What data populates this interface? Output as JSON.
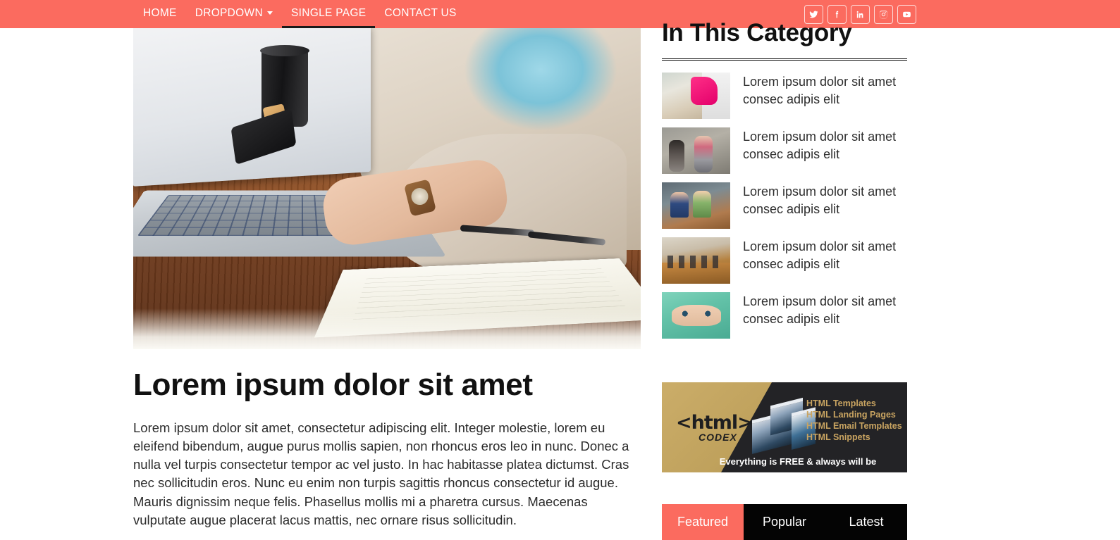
{
  "theme": {
    "accent": "#FB6B5F",
    "dark": "#040404",
    "gold": "#c9a461",
    "text": "#2b2b2b"
  },
  "navbar": {
    "items": [
      {
        "label": "HOME",
        "active": false,
        "has_caret": false
      },
      {
        "label": "DROPDOWN",
        "active": false,
        "has_caret": true
      },
      {
        "label": "SINGLE PAGE",
        "active": true,
        "has_caret": false
      },
      {
        "label": "CONTACT US",
        "active": false,
        "has_caret": false
      }
    ],
    "social": [
      {
        "name": "twitter-icon",
        "label": "Twitter"
      },
      {
        "name": "facebook-icon",
        "label": "Facebook"
      },
      {
        "name": "linkedin-icon",
        "label": "LinkedIn"
      },
      {
        "name": "instagram-icon",
        "label": "Instagram"
      },
      {
        "name": "youtube-icon",
        "label": "YouTube"
      }
    ]
  },
  "article": {
    "image_alt": "Woman typing on a laptop at a wooden desk with coffee cup, phone, notebook and pens",
    "title": "Lorem ipsum dolor sit amet",
    "body": "Lorem ipsum dolor sit amet, consectetur adipiscing elit. Integer molestie, lorem eu eleifend bibendum, augue purus mollis sapien, non rhoncus eros leo in nunc. Donec a nulla vel turpis consectetur tempor ac vel justo. In hac habitasse platea dictumst. Cras nec sollicitudin eros. Nunc eu enim non turpis sagittis rhoncus consectetur id augue. Mauris dignissim neque felis. Phasellus mollis mi a pharetra cursus. Maecenas vulputate augue placerat lacus mattis, nec ornare risus sollicitudin."
  },
  "sidebar": {
    "heading": "In This Category",
    "items": [
      {
        "text": "Lorem ipsum dolor sit amet consec adipis elit",
        "thumb": "woman-in-pink-top-with-phone"
      },
      {
        "text": "Lorem ipsum dolor sit amet consec adipis elit",
        "thumb": "women-exercising-on-stairs"
      },
      {
        "text": "Lorem ipsum dolor sit amet consec adipis elit",
        "thumb": "kids-cheering-at-laptop"
      },
      {
        "text": "Lorem ipsum dolor sit amet consec adipis elit",
        "thumb": "meeting-room-conference-table"
      },
      {
        "text": "Lorem ipsum dolor sit amet consec adipis elit",
        "thumb": "woman-in-green-headscarf"
      }
    ]
  },
  "ad": {
    "logo": "<html>",
    "logo_sub": "CODEX",
    "lines": [
      "HTML Templates",
      "HTML Landing Pages",
      "HTML Email Templates",
      "HTML Snippets"
    ],
    "footer": "Everything is FREE & always will be"
  },
  "tabs": [
    {
      "label": "Featured",
      "active": true
    },
    {
      "label": "Popular",
      "active": false
    },
    {
      "label": "Latest",
      "active": false
    }
  ]
}
